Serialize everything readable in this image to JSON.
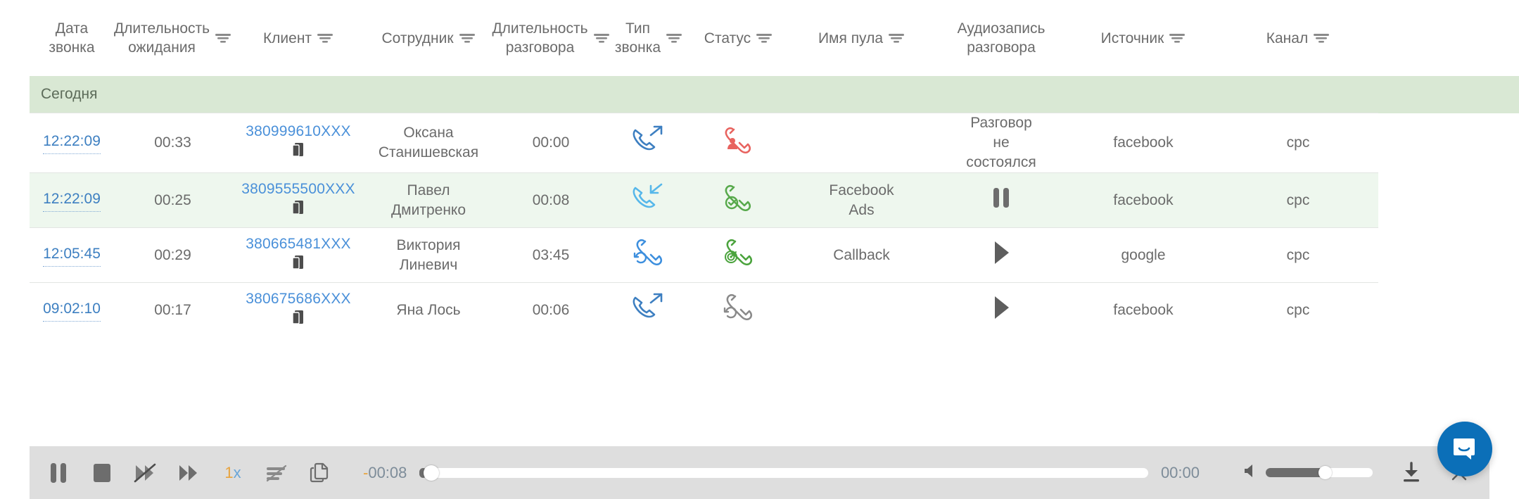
{
  "table": {
    "columns": [
      {
        "label": "Дата\nзвонка",
        "filter": false,
        "name": "call-date"
      },
      {
        "label": "Длительность\nожидания",
        "filter": true,
        "name": "wait-duration"
      },
      {
        "label": "Клиент",
        "filter": true,
        "name": "client"
      },
      {
        "label": "Сотрудник",
        "filter": true,
        "name": "employee"
      },
      {
        "label": "Длительность\nразговора",
        "filter": true,
        "name": "talk-duration"
      },
      {
        "label": "Тип\nзвонка",
        "filter": true,
        "name": "call-type"
      },
      {
        "label": "Статус",
        "filter": true,
        "name": "status"
      },
      {
        "label": "Имя пула",
        "filter": true,
        "name": "pool-name"
      },
      {
        "label": "Аудиозапись\nразговора",
        "filter": false,
        "name": "audio-record"
      },
      {
        "label": "Источник",
        "filter": true,
        "name": "source"
      },
      {
        "label": "Канал",
        "filter": true,
        "name": "channel"
      }
    ],
    "group_label": "Сегодня",
    "rows": [
      {
        "time": "12:22:09",
        "wait": "00:33",
        "phone": "380999610XXX",
        "employee": "Оксана\nСтанишевская",
        "talk": "00:00",
        "call_type_icon": "phone-outgoing-icon",
        "call_type_color": "#3d7fc1",
        "status_icon": "phone-missed-person-icon",
        "status_color": "#e8635f",
        "pool": "",
        "audio_text": "Разговор\nне\nсостоялся",
        "audio_icon": "",
        "source": "facebook",
        "channel": "cpc",
        "highlighted": false
      },
      {
        "time": "12:22:09",
        "wait": "00:25",
        "phone": "3809555500XXX",
        "employee": "Павел\nДмитренко",
        "talk": "00:08",
        "call_type_icon": "phone-incoming-icon",
        "call_type_color": "#56b7ea",
        "status_icon": "phone-answered-check-icon",
        "status_color": "#57a94b",
        "pool": "Facebook\nAds",
        "audio_text": "",
        "audio_icon": "pause-icon",
        "source": "facebook",
        "channel": "cpc",
        "highlighted": true
      },
      {
        "time": "12:05:45",
        "wait": "00:29",
        "phone": "380665481XXX",
        "employee": "Виктория\nЛиневич",
        "talk": "03:45",
        "call_type_icon": "phone-callback-icon",
        "call_type_color": "#3d8fde",
        "status_icon": "phone-target-icon",
        "status_color": "#4ba33d",
        "pool": "Callback",
        "audio_text": "",
        "audio_icon": "play-icon",
        "source": "google",
        "channel": "cpc",
        "highlighted": false
      },
      {
        "time": "09:02:10",
        "wait": "00:17",
        "phone": "380675686XXX",
        "employee": "Яна Лось",
        "talk": "00:06",
        "call_type_icon": "phone-outgoing-icon",
        "call_type_color": "#3d7fc1",
        "status_icon": "phone-callback-grey-icon",
        "status_color": "#8a8a8a",
        "pool": "",
        "audio_text": "",
        "audio_icon": "play-icon",
        "source": "facebook",
        "channel": "cpc",
        "highlighted": false
      }
    ]
  },
  "player": {
    "pause_label": "pause-icon",
    "stop_label": "stop-icon",
    "rewind_label": "rewind-disabled-icon",
    "forward_label": "fast-forward-icon",
    "rate": "1x",
    "rate_number": "1",
    "rate_suffix": "x",
    "equalizer_label": "transcript-disabled-icon",
    "copy_label": "copy-icon",
    "time_elapsed": "-00:08",
    "time_elapsed_sign": "-",
    "time_elapsed_value": "00:08",
    "time_total": "00:00",
    "seek_percent": 1,
    "volume_percent": 55,
    "download_label": "download-icon",
    "close_label": "close-icon"
  },
  "intercom": {
    "label": "chat-bubble-icon"
  },
  "colors": {
    "group_row": "#d9e8d4",
    "alt_row": "#eef7ee",
    "link": "#4a90d9",
    "accent_orange": "#e8a33d",
    "intercom_blue": "#0b6fb8"
  }
}
